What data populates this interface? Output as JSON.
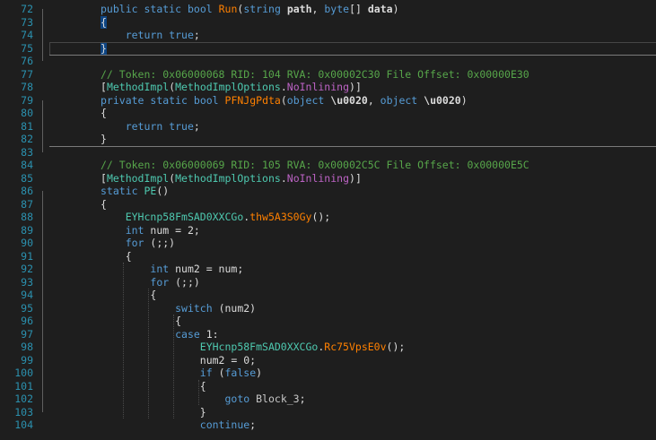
{
  "editor": {
    "lines": [
      {
        "n": "72",
        "tokens": [
          [
            "kw",
            "public"
          ],
          [
            "punc",
            " "
          ],
          [
            "kw",
            "static"
          ],
          [
            "punc",
            " "
          ],
          [
            "kw",
            "bool"
          ],
          [
            "punc",
            " "
          ],
          [
            "call",
            "Run"
          ],
          [
            "punc",
            "("
          ],
          [
            "kw",
            "string"
          ],
          [
            "punc",
            " "
          ],
          [
            "b",
            "path"
          ],
          [
            "punc",
            ", "
          ],
          [
            "kw",
            "byte"
          ],
          [
            "punc",
            "[] "
          ],
          [
            "b",
            "data"
          ],
          [
            "punc",
            ")"
          ]
        ]
      },
      {
        "n": "73",
        "tokens": [
          [
            "hl",
            "{"
          ]
        ]
      },
      {
        "n": "74",
        "tokens": [
          [
            "punc",
            "    "
          ],
          [
            "kw",
            "return"
          ],
          [
            "punc",
            " "
          ],
          [
            "kw",
            "true"
          ],
          [
            "punc",
            ";"
          ]
        ]
      },
      {
        "n": "75",
        "tokens": [
          [
            "hl",
            "}"
          ]
        ]
      },
      {
        "n": "76",
        "tokens": []
      },
      {
        "n": "77",
        "tokens": [
          [
            "cmt",
            "// Token: 0x06000068 RID: 104 RVA: 0x00002C30 File Offset: 0x00000E30"
          ]
        ]
      },
      {
        "n": "78",
        "tokens": [
          [
            "punc",
            "["
          ],
          [
            "cls",
            "MethodImpl"
          ],
          [
            "punc",
            "("
          ],
          [
            "cls",
            "MethodImplOptions"
          ],
          [
            "punc",
            "."
          ],
          [
            "enmm",
            "NoInlining"
          ],
          [
            "punc",
            ")]"
          ]
        ]
      },
      {
        "n": "79",
        "tokens": [
          [
            "kw",
            "private"
          ],
          [
            "punc",
            " "
          ],
          [
            "kw",
            "static"
          ],
          [
            "punc",
            " "
          ],
          [
            "kw",
            "bool"
          ],
          [
            "punc",
            " "
          ],
          [
            "call",
            "PFNJgPdta"
          ],
          [
            "punc",
            "("
          ],
          [
            "kw",
            "object"
          ],
          [
            "punc",
            " "
          ],
          [
            "b",
            "\\u0020"
          ],
          [
            "punc",
            ", "
          ],
          [
            "kw",
            "object"
          ],
          [
            "punc",
            " "
          ],
          [
            "b",
            "\\u0020"
          ],
          [
            "punc",
            ")"
          ]
        ]
      },
      {
        "n": "80",
        "tokens": [
          [
            "punc",
            "{"
          ]
        ]
      },
      {
        "n": "81",
        "tokens": [
          [
            "punc",
            "    "
          ],
          [
            "kw",
            "return"
          ],
          [
            "punc",
            " "
          ],
          [
            "kw",
            "true"
          ],
          [
            "punc",
            ";"
          ]
        ]
      },
      {
        "n": "82",
        "tokens": [
          [
            "punc",
            "}"
          ]
        ]
      },
      {
        "n": "83",
        "tokens": []
      },
      {
        "n": "84",
        "tokens": [
          [
            "cmt",
            "// Token: 0x06000069 RID: 105 RVA: 0x00002C5C File Offset: 0x00000E5C"
          ]
        ]
      },
      {
        "n": "85",
        "tokens": [
          [
            "punc",
            "["
          ],
          [
            "cls",
            "MethodImpl"
          ],
          [
            "punc",
            "("
          ],
          [
            "cls",
            "MethodImplOptions"
          ],
          [
            "punc",
            "."
          ],
          [
            "enmm",
            "NoInlining"
          ],
          [
            "punc",
            ")]"
          ]
        ]
      },
      {
        "n": "86",
        "tokens": [
          [
            "kw",
            "static"
          ],
          [
            "punc",
            " "
          ],
          [
            "cls",
            "PE"
          ],
          [
            "punc",
            "()"
          ]
        ]
      },
      {
        "n": "87",
        "tokens": [
          [
            "punc",
            "{"
          ]
        ]
      },
      {
        "n": "88",
        "tokens": [
          [
            "punc",
            "    "
          ],
          [
            "cls",
            "EYHcnp58FmSAD0XXCGo"
          ],
          [
            "punc",
            "."
          ],
          [
            "call",
            "thw5A3S0Gy"
          ],
          [
            "punc",
            "();"
          ]
        ]
      },
      {
        "n": "89",
        "tokens": [
          [
            "punc",
            "    "
          ],
          [
            "kw",
            "int"
          ],
          [
            "punc",
            " num = 2;"
          ]
        ]
      },
      {
        "n": "90",
        "tokens": [
          [
            "punc",
            "    "
          ],
          [
            "kw",
            "for"
          ],
          [
            "punc",
            " (;;)"
          ]
        ]
      },
      {
        "n": "91",
        "tokens": [
          [
            "punc",
            "    {"
          ]
        ]
      },
      {
        "n": "92",
        "tokens": [
          [
            "punc",
            "        "
          ],
          [
            "kw",
            "int"
          ],
          [
            "punc",
            " num2 = num;"
          ]
        ]
      },
      {
        "n": "93",
        "tokens": [
          [
            "punc",
            "        "
          ],
          [
            "kw",
            "for"
          ],
          [
            "punc",
            " (;;)"
          ]
        ]
      },
      {
        "n": "94",
        "tokens": [
          [
            "punc",
            "        {"
          ]
        ]
      },
      {
        "n": "95",
        "tokens": [
          [
            "punc",
            "            "
          ],
          [
            "kw",
            "switch"
          ],
          [
            "punc",
            " (num2)"
          ]
        ]
      },
      {
        "n": "96",
        "tokens": [
          [
            "punc",
            "            {"
          ]
        ]
      },
      {
        "n": "97",
        "tokens": [
          [
            "punc",
            "            "
          ],
          [
            "kw",
            "case"
          ],
          [
            "punc",
            " 1:"
          ]
        ]
      },
      {
        "n": "98",
        "tokens": [
          [
            "punc",
            "                "
          ],
          [
            "cls",
            "EYHcnp58FmSAD0XXCGo"
          ],
          [
            "punc",
            "."
          ],
          [
            "call",
            "Rc75VpsE0v"
          ],
          [
            "punc",
            "();"
          ]
        ]
      },
      {
        "n": "99",
        "tokens": [
          [
            "punc",
            "                num2 = 0;"
          ]
        ]
      },
      {
        "n": "100",
        "tokens": [
          [
            "punc",
            "                "
          ],
          [
            "kw",
            "if"
          ],
          [
            "punc",
            " ("
          ],
          [
            "kw",
            "false"
          ],
          [
            "punc",
            ")"
          ]
        ]
      },
      {
        "n": "101",
        "tokens": [
          [
            "punc",
            "                {"
          ]
        ]
      },
      {
        "n": "102",
        "tokens": [
          [
            "punc",
            "                    "
          ],
          [
            "kw",
            "goto"
          ],
          [
            "punc",
            " "
          ],
          [
            "lbl",
            "Block_3"
          ],
          [
            "punc",
            ";"
          ]
        ]
      },
      {
        "n": "103",
        "tokens": [
          [
            "punc",
            "                }"
          ]
        ]
      },
      {
        "n": "104",
        "tokens": [
          [
            "punc",
            "                "
          ],
          [
            "kw",
            "continue"
          ],
          [
            "punc",
            ";"
          ]
        ]
      }
    ]
  }
}
